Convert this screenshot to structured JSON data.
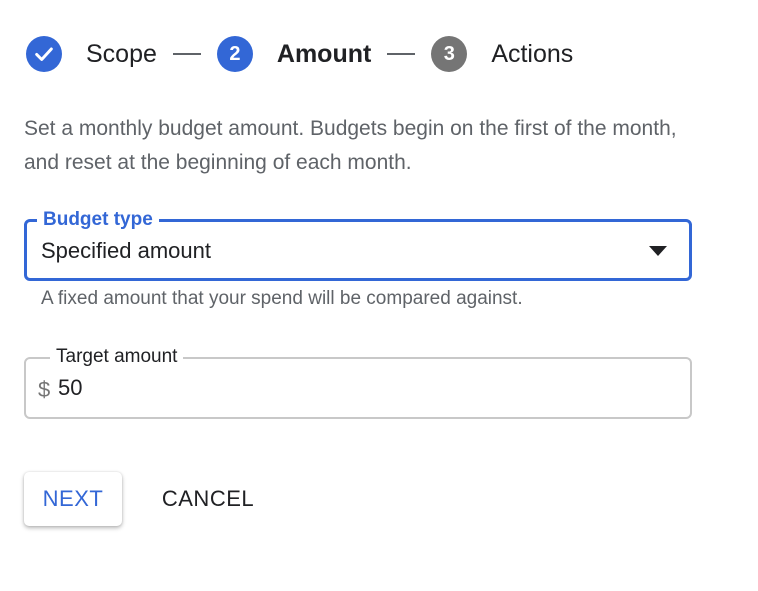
{
  "stepper": {
    "steps": [
      {
        "number": "",
        "label": "Scope",
        "state": "completed",
        "icon": "check-icon"
      },
      {
        "number": "2",
        "label": "Amount",
        "state": "active"
      },
      {
        "number": "3",
        "label": "Actions",
        "state": "upcoming"
      }
    ]
  },
  "description": "Set a monthly budget amount. Budgets begin on the first of the month, and reset at the beginning of each month.",
  "budget_type": {
    "label": "Budget type",
    "value": "Specified amount",
    "helper": "A fixed amount that your spend will be compared against.",
    "icon": "dropdown-arrow-icon"
  },
  "target_amount": {
    "label": "Target amount",
    "prefix": "$",
    "value": "50"
  },
  "buttons": {
    "next": "NEXT",
    "cancel": "CANCEL"
  },
  "colors": {
    "accent": "#3367d6",
    "inactive_step": "#757575",
    "secondary_text": "#5f6368"
  }
}
